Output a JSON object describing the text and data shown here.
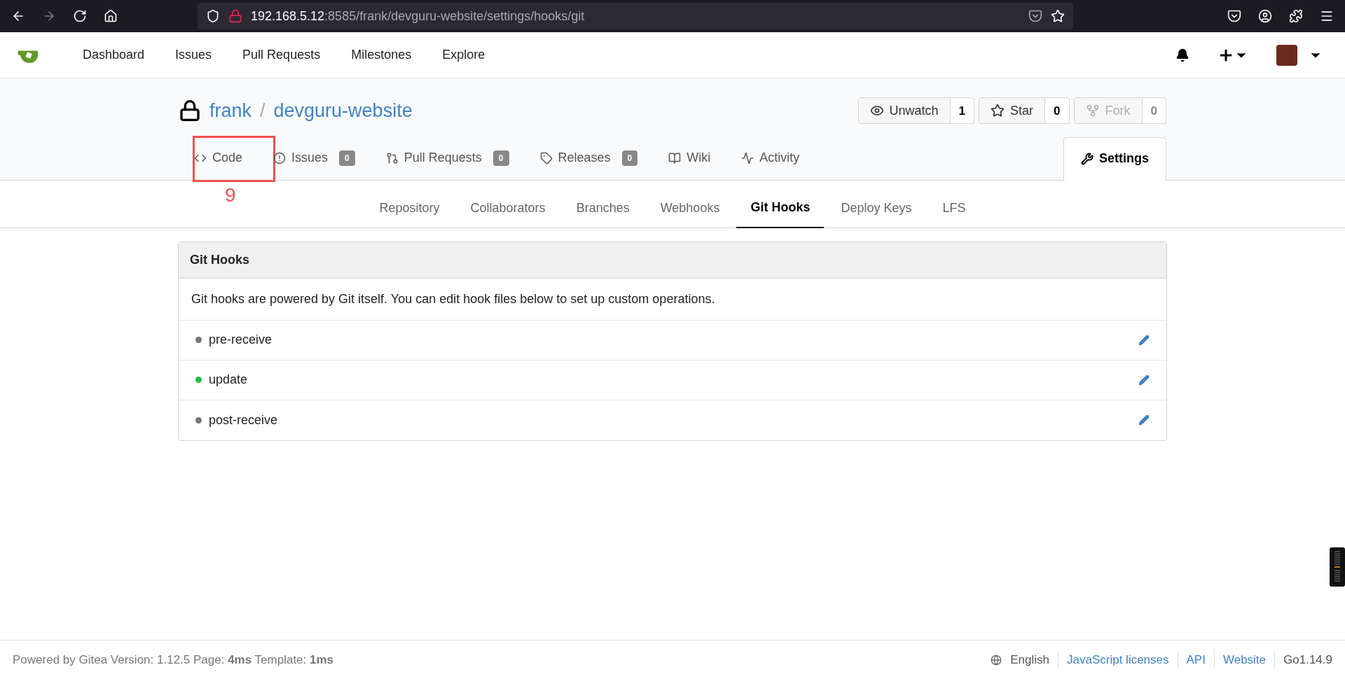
{
  "browser": {
    "url_host": "192.168.5.12",
    "url_path": ":8585/frank/devguru-website/settings/hooks/git"
  },
  "navbar": {
    "items": [
      {
        "label": "Dashboard"
      },
      {
        "label": "Issues"
      },
      {
        "label": "Pull Requests"
      },
      {
        "label": "Milestones"
      },
      {
        "label": "Explore"
      }
    ]
  },
  "repo": {
    "owner": "frank",
    "separator": "/",
    "name": "devguru-website",
    "actions": [
      {
        "label": "Unwatch",
        "count": "1",
        "disabled": false
      },
      {
        "label": "Star",
        "count": "0",
        "disabled": false
      },
      {
        "label": "Fork",
        "count": "0",
        "disabled": true
      }
    ],
    "tabs": [
      {
        "kind": "code",
        "label": "Code",
        "selected": false
      },
      {
        "kind": "issues",
        "label": "Issues",
        "count": "0",
        "selected": false
      },
      {
        "kind": "pulls",
        "label": "Pull Requests",
        "count": "0",
        "selected": false
      },
      {
        "kind": "releases",
        "label": "Releases",
        "count": "0",
        "selected": false
      },
      {
        "kind": "wiki",
        "label": "Wiki",
        "selected": false
      },
      {
        "kind": "activity",
        "label": "Activity",
        "selected": false
      },
      {
        "kind": "settings",
        "label": "Settings",
        "selected": true
      }
    ]
  },
  "annotation": {
    "label": "9"
  },
  "settings_nav": [
    {
      "label": "Repository",
      "selected": false
    },
    {
      "label": "Collaborators",
      "selected": false
    },
    {
      "label": "Branches",
      "selected": false
    },
    {
      "label": "Webhooks",
      "selected": false
    },
    {
      "label": "Git Hooks",
      "selected": true
    },
    {
      "label": "Deploy Keys",
      "selected": false
    },
    {
      "label": "LFS",
      "selected": false
    }
  ],
  "panel": {
    "title": "Git Hooks",
    "description": "Git hooks are powered by Git itself. You can edit hook files below to set up custom operations.",
    "hooks": [
      {
        "name": "pre-receive",
        "color": "#767676"
      },
      {
        "name": "update",
        "color": "#21ba45"
      },
      {
        "name": "post-receive",
        "color": "#767676"
      }
    ]
  },
  "footer": {
    "info": "Powered by Gitea Version: 1.12.5 Page: **4ms** Template: **1ms**",
    "language": "English",
    "links": [
      "JavaScript licenses",
      "API",
      "Website"
    ],
    "go_version": "Go1.14.9"
  }
}
